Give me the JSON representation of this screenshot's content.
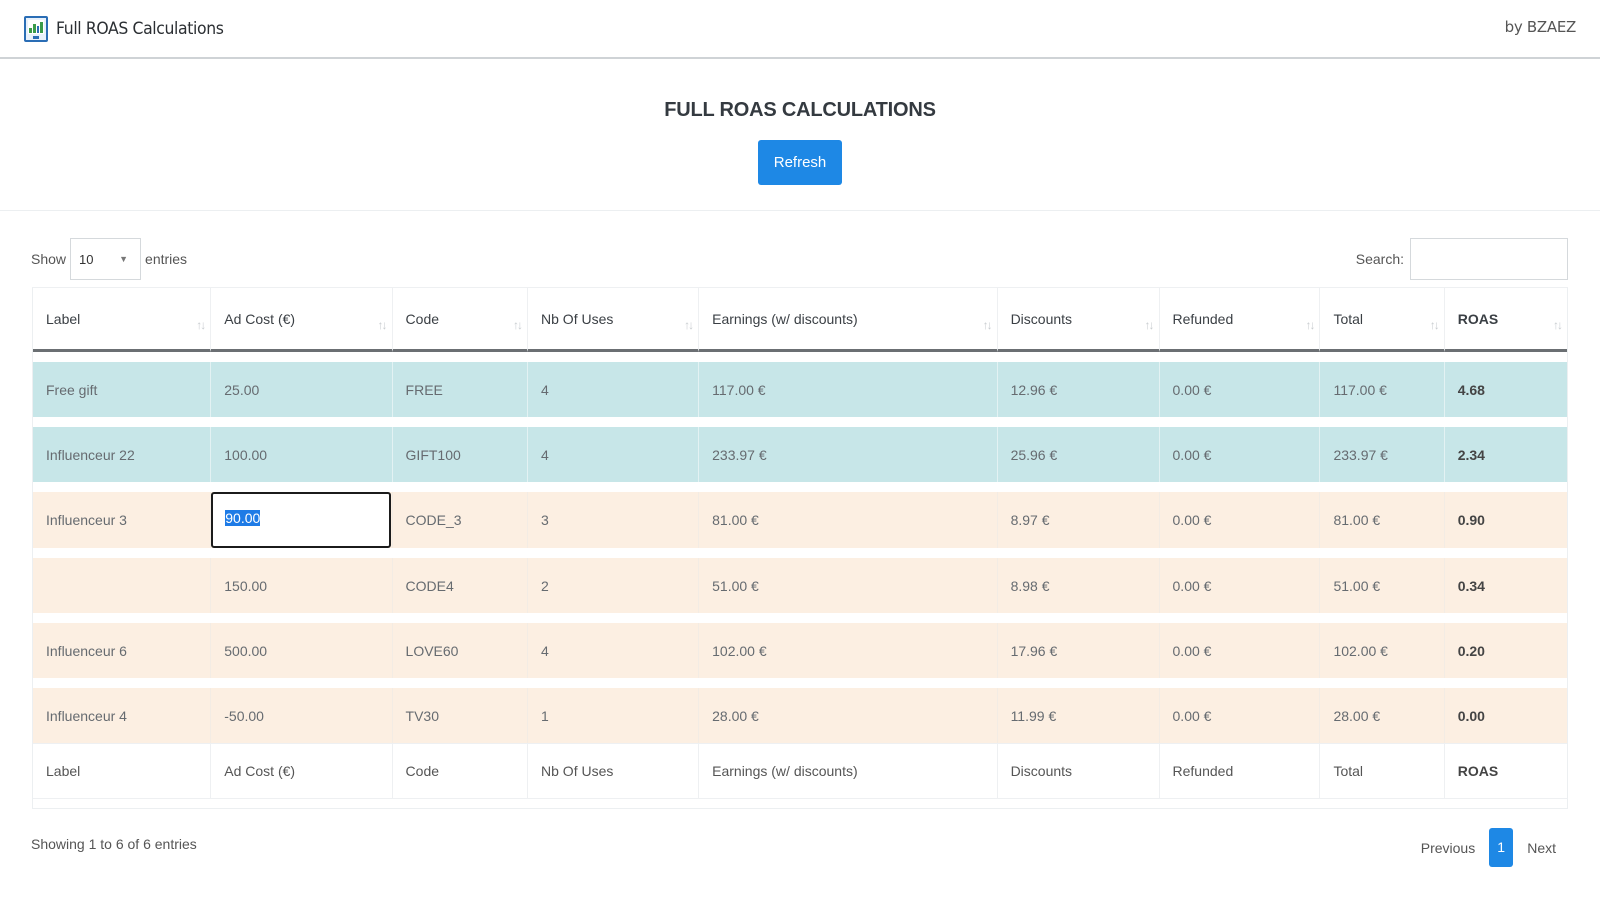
{
  "app": {
    "title": "Full ROAS Calculations",
    "byline": "by BZAEZ",
    "icon": "monitor-chart-icon"
  },
  "hero": {
    "heading": "FULL ROAS CALCULATIONS",
    "refresh_label": "Refresh",
    "accent_color": "#1e88e5"
  },
  "controls": {
    "show_label": "Show",
    "entries_label": "entries",
    "page_length": "10",
    "search_label": "Search:",
    "search_value": ""
  },
  "table": {
    "columns": [
      "Label",
      "Ad Cost (€)",
      "Code",
      "Nb Of Uses",
      "Earnings (w/ discounts)",
      "Discounts",
      "Refunded",
      "Total",
      "ROAS"
    ],
    "rows": [
      {
        "label": "Free gift",
        "ad_cost": "25.00",
        "code": "FREE",
        "uses": "4",
        "earnings": "117.00 €",
        "discounts": "12.96 €",
        "refunded": "0.00 €",
        "total": "117.00 €",
        "roas": "4.68",
        "tone": "teal"
      },
      {
        "label": "Influenceur 22",
        "ad_cost": "100.00",
        "code": "GIFT100",
        "uses": "4",
        "earnings": "233.97 €",
        "discounts": "25.96 €",
        "refunded": "0.00 €",
        "total": "233.97 €",
        "roas": "2.34",
        "tone": "teal"
      },
      {
        "label": "Influenceur 3",
        "ad_cost": "90.00",
        "code": "CODE_3",
        "uses": "3",
        "earnings": "81.00 €",
        "discounts": "8.97 €",
        "refunded": "0.00 €",
        "total": "81.00 €",
        "roas": "0.90",
        "tone": "peach",
        "editing": true
      },
      {
        "label": "",
        "ad_cost": "150.00",
        "code": "CODE4",
        "uses": "2",
        "earnings": "51.00 €",
        "discounts": "8.98 €",
        "refunded": "0.00 €",
        "total": "51.00 €",
        "roas": "0.34",
        "tone": "peach"
      },
      {
        "label": "Influenceur 6",
        "ad_cost": "500.00",
        "code": "LOVE60",
        "uses": "4",
        "earnings": "102.00 €",
        "discounts": "17.96 €",
        "refunded": "0.00 €",
        "total": "102.00 €",
        "roas": "0.20",
        "tone": "peach"
      },
      {
        "label": "Influenceur 4",
        "ad_cost": "-50.00",
        "code": "TV30",
        "uses": "1",
        "earnings": "28.00 €",
        "discounts": "11.99 €",
        "refunded": "0.00 €",
        "total": "28.00 €",
        "roas": "0.00",
        "tone": "peach"
      }
    ],
    "row_colors": {
      "teal": "#c7e6e8",
      "peach": "#fcefe2"
    }
  },
  "footer": {
    "info": "Showing 1 to 6 of 6 entries",
    "previous_label": "Previous",
    "current_page": "1",
    "next_label": "Next"
  }
}
